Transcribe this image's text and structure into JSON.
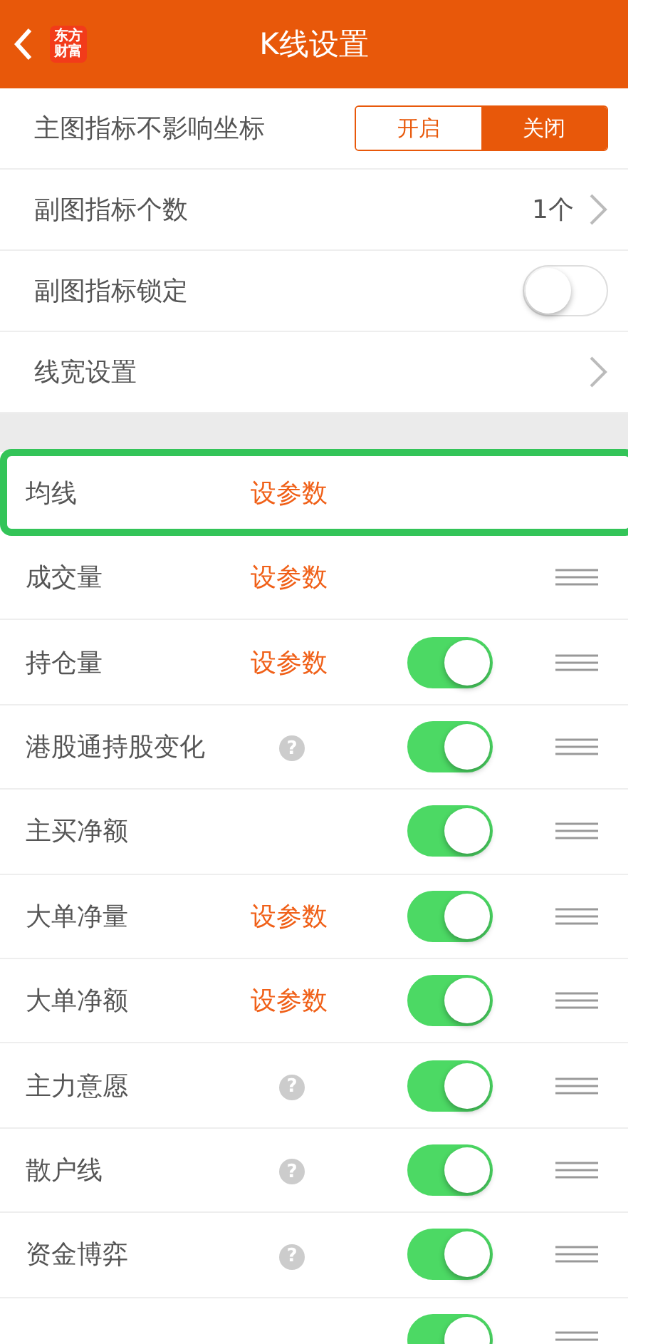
{
  "header": {
    "logo_lines": [
      "东方",
      "财富"
    ],
    "title": "K线设置"
  },
  "settings": [
    {
      "kind": "segmented",
      "label": "主图指标不影响坐标",
      "options": [
        {
          "label": "开启",
          "selected": false
        },
        {
          "label": "关闭",
          "selected": true
        }
      ]
    },
    {
      "kind": "value",
      "label": "副图指标个数",
      "value": "1个"
    },
    {
      "kind": "switch",
      "label": "副图指标锁定",
      "on": false
    },
    {
      "kind": "link",
      "label": "线宽设置"
    }
  ],
  "indicators": [
    {
      "label": "均线",
      "param": "设参数",
      "highlighted": true,
      "reorderable": false
    },
    {
      "label": "成交量",
      "param": "设参数",
      "highlighted": false,
      "reorderable": true
    },
    {
      "label": "持仓量",
      "param": "设参数",
      "on": true,
      "highlighted": false,
      "reorderable": true
    },
    {
      "label": "港股通持股变化",
      "help": "?",
      "on": true,
      "highlighted": false,
      "reorderable": true
    },
    {
      "label": "主买净额",
      "on": true,
      "highlighted": false,
      "reorderable": true
    },
    {
      "label": "大单净量",
      "param": "设参数",
      "on": true,
      "highlighted": false,
      "reorderable": true
    },
    {
      "label": "大单净额",
      "param": "设参数",
      "on": true,
      "highlighted": false,
      "reorderable": true
    },
    {
      "label": "主力意愿",
      "help": "?",
      "on": true,
      "highlighted": false,
      "reorderable": true
    },
    {
      "label": "散户线",
      "help": "?",
      "on": true,
      "highlighted": false,
      "reorderable": true
    },
    {
      "label": "资金博弈",
      "help": "?",
      "on": true,
      "highlighted": false,
      "reorderable": true
    },
    {
      "on": true,
      "highlighted": false,
      "reorderable": true
    }
  ]
}
